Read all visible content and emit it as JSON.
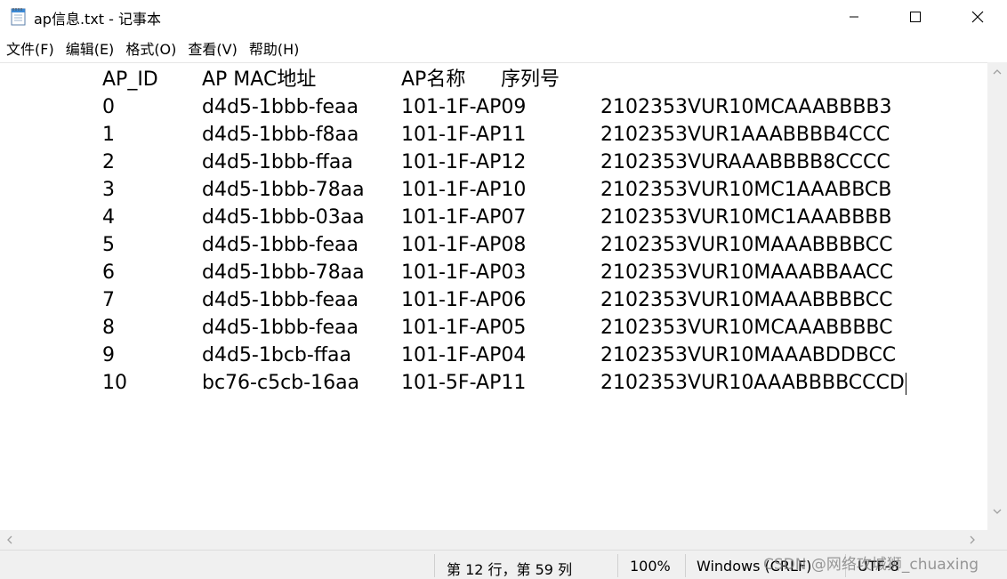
{
  "window": {
    "title": "ap信息.txt - 记事本",
    "icon": "notepad-icon"
  },
  "menu": {
    "items": [
      {
        "label": "文件(F)"
      },
      {
        "label": "编辑(E)"
      },
      {
        "label": "格式(O)"
      },
      {
        "label": "查看(V)"
      },
      {
        "label": "帮助(H)"
      }
    ]
  },
  "document": {
    "header": {
      "id": "AP_ID",
      "mac": "AP MAC地址",
      "name": "AP名称",
      "serial": "序列号"
    },
    "rows": [
      {
        "id": "0",
        "mac": "d4d5-1bbb-feaa",
        "name": "101-1F-AP09",
        "serial": "2102353VUR10MCAAABBBB3"
      },
      {
        "id": "1",
        "mac": "d4d5-1bbb-f8aa",
        "name": "101-1F-AP11",
        "serial": "2102353VUR1AAABBBB4CCC"
      },
      {
        "id": "2",
        "mac": "d4d5-1bbb-ffaa",
        "name": "101-1F-AP12",
        "serial": "2102353VURAAABBBB8CCCC"
      },
      {
        "id": "3",
        "mac": "d4d5-1bbb-78aa",
        "name": "101-1F-AP10",
        "serial": "2102353VUR10MC1AAABBCB"
      },
      {
        "id": "4",
        "mac": "d4d5-1bbb-03aa",
        "name": "101-1F-AP07",
        "serial": "2102353VUR10MC1AAABBBB"
      },
      {
        "id": "5",
        "mac": "d4d5-1bbb-feaa",
        "name": "101-1F-AP08",
        "serial": "2102353VUR10MAAABBBBCC"
      },
      {
        "id": "6",
        "mac": "d4d5-1bbb-78aa",
        "name": "101-1F-AP03",
        "serial": "2102353VUR10MAAABBAACC"
      },
      {
        "id": "7",
        "mac": "d4d5-1bbb-feaa",
        "name": "101-1F-AP06",
        "serial": "2102353VUR10MAAABBBBCC"
      },
      {
        "id": "8",
        "mac": "d4d5-1bbb-feaa",
        "name": "101-1F-AP05",
        "serial": "2102353VUR10MCAAABBBBC"
      },
      {
        "id": "9",
        "mac": "d4d5-1bcb-ffaa",
        "name": "101-1F-AP04",
        "serial": "2102353VUR10MAAABDDBCC"
      },
      {
        "id": "10",
        "mac": "bc76-c5cb-16aa",
        "name": "101-5F-AP11",
        "serial": "2102353VUR10AAABBBBCCCD"
      }
    ]
  },
  "status": {
    "position": "第 12 行，第 59 列",
    "zoom": "100%",
    "line_ending": "Windows (CRLF)",
    "encoding": "UTF-8"
  },
  "watermark": "CSDN @网络攻城狮_chuaxing"
}
